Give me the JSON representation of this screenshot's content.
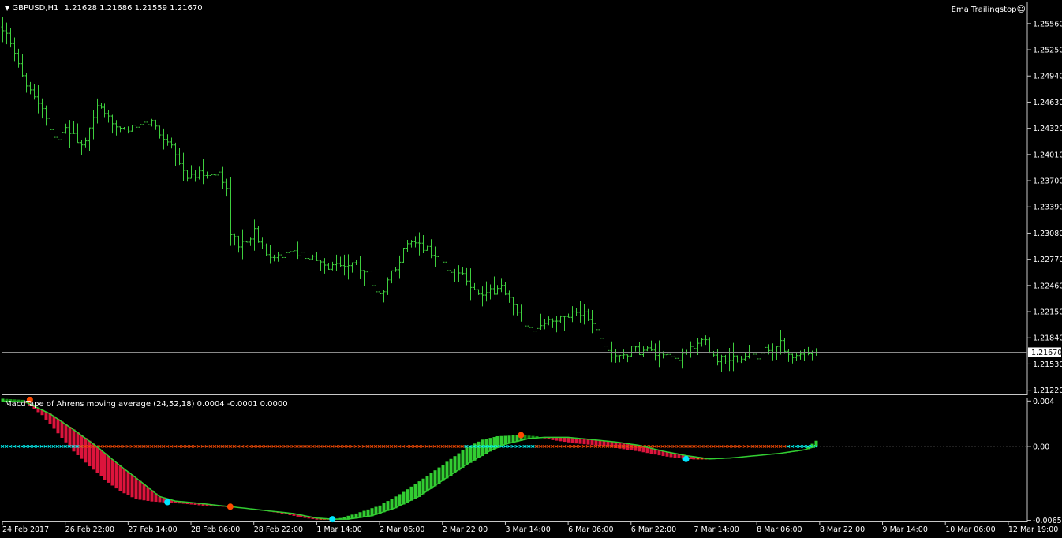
{
  "main_window": {
    "symbol_tf": "GBPUSD,H1",
    "ohlc": "1.21628 1.21686 1.21559 1.21670",
    "expert_name": "Ema Trailingstop",
    "expert_icon": "smiley-face-icon"
  },
  "indicator_window": {
    "label": "MacdTape of Ahrens moving average (24,52,18) 0.0004 -0.0001 0.0000"
  },
  "colors": {
    "background": "#000000",
    "frame": "#c8c8c8",
    "bar_color": "#3ecf3e",
    "bid_line": "#8a8a8a",
    "tape_up_light": "#32cd32",
    "tape_up_dark": "#138f13",
    "tape_down_light": "#ff5a1f",
    "tape_down_dark": "#dc143c",
    "signal_line": "#32cd32",
    "signal_up_dot": "#00e5ff",
    "signal_down_dot": "#ff4a00",
    "zero_line_up": "#00ffff",
    "zero_line_down": "#ff4a00"
  },
  "chart_data": [
    {
      "type": "ohlc-bar",
      "symbol": "GBPUSD",
      "timeframe": "H1",
      "y_ticks": [
        "1.25560",
        "1.25250",
        "1.24940",
        "1.24630",
        "1.24320",
        "1.24010",
        "1.23700",
        "1.23390",
        "1.23080",
        "1.22770",
        "1.22460",
        "1.22150",
        "1.21840",
        "1.21530",
        "1.21220"
      ],
      "ylim": [
        1.2117,
        1.2582
      ],
      "current_price": "1.21670",
      "x_ticks": [
        "24 Feb 2017",
        "26 Feb 22:00",
        "27 Feb 14:00",
        "28 Feb 06:00",
        "28 Feb 22:00",
        "1 Mar 14:00",
        "2 Mar 06:00",
        "2 Mar 22:00",
        "3 Mar 14:00",
        "6 Mar 06:00",
        "6 Mar 22:00",
        "7 Mar 14:00",
        "8 Mar 06:00",
        "8 Mar 22:00",
        "9 Mar 14:00",
        "10 Mar 06:00",
        "12 Mar 19:00"
      ],
      "n_bars": 208,
      "bar_spacing_bars_per_tick": 16,
      "close_anchors": [
        [
          0,
          1.2552
        ],
        [
          3,
          1.2518
        ],
        [
          5,
          1.2495
        ],
        [
          8,
          1.247
        ],
        [
          10,
          1.2458
        ],
        [
          12,
          1.243
        ],
        [
          14,
          1.242
        ],
        [
          16,
          1.243
        ],
        [
          18,
          1.2425
        ],
        [
          20,
          1.241
        ],
        [
          22,
          1.2428
        ],
        [
          24,
          1.246
        ],
        [
          26,
          1.2445
        ],
        [
          28,
          1.244
        ],
        [
          30,
          1.2435
        ],
        [
          32,
          1.243
        ],
        [
          35,
          1.2435
        ],
        [
          38,
          1.244
        ],
        [
          41,
          1.242
        ],
        [
          43,
          1.2415
        ],
        [
          45,
          1.239
        ],
        [
          47,
          1.2375
        ],
        [
          49,
          1.2375
        ],
        [
          51,
          1.238
        ],
        [
          53,
          1.2375
        ],
        [
          55,
          1.238
        ],
        [
          57,
          1.236
        ],
        [
          58,
          1.231
        ],
        [
          60,
          1.2292
        ],
        [
          62,
          1.23
        ],
        [
          64,
          1.231
        ],
        [
          66,
          1.229
        ],
        [
          68,
          1.2283
        ],
        [
          70,
          1.2282
        ],
        [
          72,
          1.2282
        ],
        [
          75,
          1.2285
        ],
        [
          78,
          1.228
        ],
        [
          80,
          1.2275
        ],
        [
          82,
          1.2268
        ],
        [
          85,
          1.227
        ],
        [
          88,
          1.2272
        ],
        [
          90,
          1.227
        ],
        [
          93,
          1.2262
        ],
        [
          95,
          1.2235
        ],
        [
          97,
          1.2242
        ],
        [
          99,
          1.226
        ],
        [
          101,
          1.2278
        ],
        [
          103,
          1.2293
        ],
        [
          105,
          1.2295
        ],
        [
          108,
          1.229
        ],
        [
          110,
          1.228
        ],
        [
          112,
          1.2273
        ],
        [
          114,
          1.226
        ],
        [
          116,
          1.2265
        ],
        [
          118,
          1.2255
        ],
        [
          120,
          1.224
        ],
        [
          122,
          1.2233
        ],
        [
          125,
          1.224
        ],
        [
          127,
          1.2245
        ],
        [
          129,
          1.223
        ],
        [
          131,
          1.2212
        ],
        [
          133,
          1.2195
        ],
        [
          135,
          1.219
        ],
        [
          137,
          1.22
        ],
        [
          139,
          1.221
        ],
        [
          141,
          1.2205
        ],
        [
          143,
          1.221
        ],
        [
          145,
          1.2215
        ],
        [
          148,
          1.2212
        ],
        [
          150,
          1.22
        ],
        [
          152,
          1.2182
        ],
        [
          154,
          1.2168
        ],
        [
          156,
          1.216
        ],
        [
          158,
          1.2163
        ],
        [
          160,
          1.217
        ],
        [
          162,
          1.2168
        ],
        [
          164,
          1.217
        ],
        [
          166,
          1.2165
        ],
        [
          168,
          1.216
        ],
        [
          170,
          1.216
        ],
        [
          172,
          1.2158
        ],
        [
          174,
          1.217
        ],
        [
          176,
          1.217
        ],
        [
          178,
          1.2185
        ],
        [
          180,
          1.217
        ],
        [
          182,
          1.2158
        ],
        [
          185,
          1.216
        ],
        [
          188,
          1.2158
        ],
        [
          190,
          1.2165
        ],
        [
          192,
          1.216
        ],
        [
          194,
          1.2175
        ],
        [
          196,
          1.217
        ],
        [
          198,
          1.218
        ],
        [
          200,
          1.2165
        ],
        [
          202,
          1.216
        ],
        [
          204,
          1.2165
        ],
        [
          206,
          1.217
        ],
        [
          207,
          1.2167
        ]
      ]
    },
    {
      "type": "oscillator-tape",
      "name": "MacdTape of Ahrens moving average",
      "params": [
        24,
        52,
        18
      ],
      "values": [
        0.0004,
        -0.0001,
        0.0
      ],
      "y_ticks": [
        "0.004",
        "0.00",
        "-0.0065"
      ],
      "ylim": [
        -0.0066,
        0.0043
      ],
      "main_anchors": [
        [
          0,
          0.0042
        ],
        [
          5,
          0.0041
        ],
        [
          10,
          0.0028
        ],
        [
          14,
          0.0012
        ],
        [
          18,
          -0.0004
        ],
        [
          22,
          -0.0017
        ],
        [
          26,
          -0.0029
        ],
        [
          30,
          -0.0039
        ],
        [
          34,
          -0.0046
        ],
        [
          38,
          -0.0048
        ],
        [
          42,
          -0.0049
        ],
        [
          46,
          -0.005
        ],
        [
          52,
          -0.0052
        ],
        [
          58,
          -0.0053
        ],
        [
          64,
          -0.0055
        ],
        [
          70,
          -0.0058
        ],
        [
          76,
          -0.0062
        ],
        [
          80,
          -0.0064
        ],
        [
          84,
          -0.0064
        ],
        [
          86,
          -0.0063
        ],
        [
          90,
          -0.0059
        ],
        [
          96,
          -0.0052
        ],
        [
          102,
          -0.004
        ],
        [
          108,
          -0.0026
        ],
        [
          114,
          -0.0011
        ],
        [
          118,
          -0.0001
        ],
        [
          122,
          0.0006
        ],
        [
          126,
          0.0009
        ],
        [
          132,
          0.001
        ],
        [
          136,
          0.0009
        ],
        [
          140,
          0.0006
        ],
        [
          146,
          0.0003
        ],
        [
          152,
          0.0001
        ],
        [
          156,
          -0.0001
        ],
        [
          162,
          -0.0004
        ],
        [
          168,
          -0.0008
        ],
        [
          172,
          -0.001
        ],
        [
          176,
          -0.0011
        ],
        [
          180,
          -0.0011
        ],
        [
          186,
          -0.001
        ],
        [
          192,
          -0.0008
        ],
        [
          198,
          -0.0006
        ],
        [
          204,
          -0.0003
        ],
        [
          207,
          0.0005
        ]
      ],
      "signal_anchors": [
        [
          0,
          0.004
        ],
        [
          6,
          0.0039
        ],
        [
          12,
          0.0029
        ],
        [
          18,
          0.0015
        ],
        [
          24,
          0.0
        ],
        [
          30,
          -0.0017
        ],
        [
          36,
          -0.0033
        ],
        [
          40,
          -0.0044
        ],
        [
          44,
          -0.0048
        ],
        [
          50,
          -0.005
        ],
        [
          58,
          -0.0053
        ],
        [
          66,
          -0.0056
        ],
        [
          74,
          -0.0059
        ],
        [
          80,
          -0.0063
        ],
        [
          84,
          -0.0064
        ],
        [
          88,
          -0.0064
        ],
        [
          94,
          -0.0061
        ],
        [
          100,
          -0.0054
        ],
        [
          106,
          -0.0044
        ],
        [
          112,
          -0.003
        ],
        [
          118,
          -0.0016
        ],
        [
          124,
          -0.0004
        ],
        [
          128,
          0.0002
        ],
        [
          134,
          0.0007
        ],
        [
          138,
          0.0008
        ],
        [
          144,
          0.0008
        ],
        [
          150,
          0.0006
        ],
        [
          156,
          0.0004
        ],
        [
          162,
          0.0001
        ],
        [
          168,
          -0.0004
        ],
        [
          174,
          -0.0008
        ],
        [
          180,
          -0.0011
        ],
        [
          186,
          -0.001
        ],
        [
          192,
          -0.0008
        ],
        [
          198,
          -0.0006
        ],
        [
          204,
          -0.0003
        ],
        [
          207,
          0.0
        ]
      ],
      "signal_dots": [
        {
          "bar": 7,
          "value": 0.0041,
          "dir": "down"
        },
        {
          "bar": 42,
          "value": -0.0049,
          "dir": "up"
        },
        {
          "bar": 58,
          "value": -0.0053,
          "dir": "down"
        },
        {
          "bar": 84,
          "value": -0.0064,
          "dir": "up"
        },
        {
          "bar": 132,
          "value": 0.001,
          "dir": "down"
        },
        {
          "bar": 174,
          "value": -0.0011,
          "dir": "up"
        }
      ],
      "zero_line_segments": [
        {
          "from_bar": 0,
          "to_bar": 20,
          "dir": "up"
        },
        {
          "from_bar": 20,
          "to_bar": 118,
          "dir": "down"
        },
        {
          "from_bar": 118,
          "to_bar": 136,
          "dir": "up"
        },
        {
          "from_bar": 136,
          "to_bar": 200,
          "dir": "down"
        },
        {
          "from_bar": 200,
          "to_bar": 207,
          "dir": "up"
        }
      ]
    }
  ]
}
